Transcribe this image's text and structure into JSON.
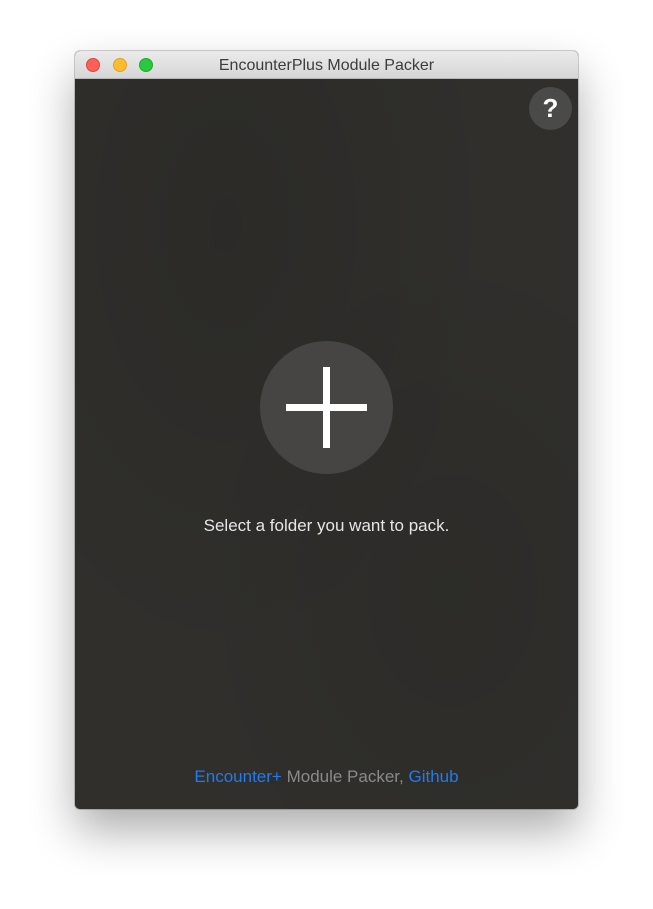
{
  "window": {
    "title": "EncounterPlus Module Packer"
  },
  "help": {
    "label": "?",
    "icon": "question-mark-icon"
  },
  "main": {
    "add_icon": "plus-icon",
    "prompt": "Select a folder you want to pack."
  },
  "footer": {
    "encounter_link": "Encounter+",
    "middle_text": " Module Packer, ",
    "github_link": "Github"
  },
  "colors": {
    "background": "#302f2c",
    "link": "#1e7bf0",
    "muted_text": "#8a8a88",
    "close": "#fe5f57",
    "minimize": "#febc2e",
    "maximize": "#28c840"
  }
}
